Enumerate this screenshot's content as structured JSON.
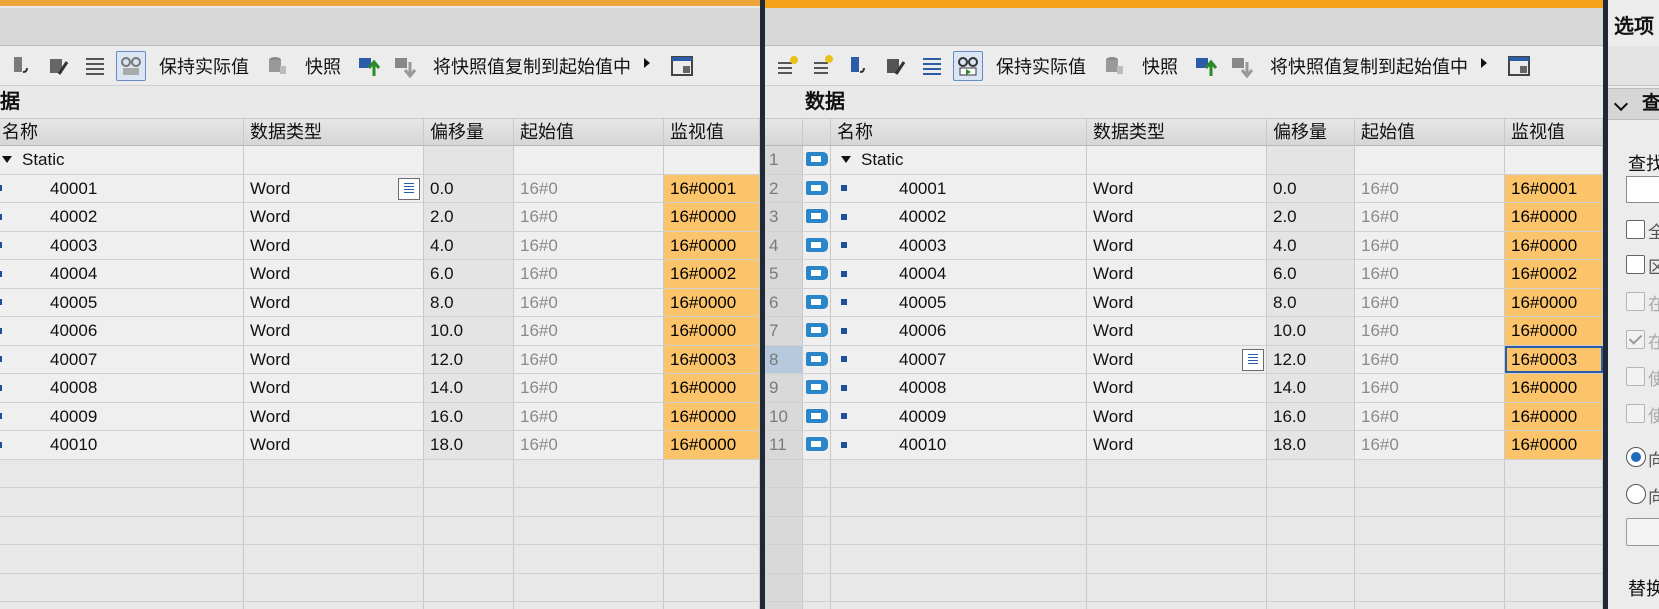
{
  "colors": {
    "accent": "#f7a31a",
    "monitor_cell": "#fbc46a",
    "tag_icon": "#2a86c8"
  },
  "toolbar": {
    "keep_actual": "保持实际值",
    "snapshot": "快照",
    "copy_snapshot": "将快照值复制到起始值中"
  },
  "left": {
    "section_title": "据",
    "headers": {
      "name": "名称",
      "type": "数据类型",
      "offset": "偏移量",
      "start": "起始值",
      "monitor": "监视值"
    },
    "group": "Static"
  },
  "right": {
    "section_title": "数据",
    "headers": {
      "name": "名称",
      "type": "数据类型",
      "offset": "偏移量",
      "start": "起始值",
      "monitor": "监视值"
    },
    "group_num": "1",
    "group": "Static"
  },
  "rows": [
    {
      "num": "2",
      "name": "40001",
      "type": "Word",
      "offset": "0.0",
      "start": "16#0",
      "monitor": "16#0001"
    },
    {
      "num": "3",
      "name": "40002",
      "type": "Word",
      "offset": "2.0",
      "start": "16#0",
      "monitor": "16#0000"
    },
    {
      "num": "4",
      "name": "40003",
      "type": "Word",
      "offset": "4.0",
      "start": "16#0",
      "monitor": "16#0000"
    },
    {
      "num": "5",
      "name": "40004",
      "type": "Word",
      "offset": "6.0",
      "start": "16#0",
      "monitor": "16#0002"
    },
    {
      "num": "6",
      "name": "40005",
      "type": "Word",
      "offset": "8.0",
      "start": "16#0",
      "monitor": "16#0000"
    },
    {
      "num": "7",
      "name": "40006",
      "type": "Word",
      "offset": "10.0",
      "start": "16#0",
      "monitor": "16#0000"
    },
    {
      "num": "8",
      "name": "40007",
      "type": "Word",
      "offset": "12.0",
      "start": "16#0",
      "monitor": "16#0003"
    },
    {
      "num": "9",
      "name": "40008",
      "type": "Word",
      "offset": "14.0",
      "start": "16#0",
      "monitor": "16#0000"
    },
    {
      "num": "10",
      "name": "40009",
      "type": "Word",
      "offset": "16.0",
      "start": "16#0",
      "monitor": "16#0000"
    },
    {
      "num": "11",
      "name": "40010",
      "type": "Word",
      "offset": "18.0",
      "start": "16#0",
      "monitor": "16#0000"
    }
  ],
  "sidepanel": {
    "title": "选项",
    "section": "查",
    "find_label": "查找",
    "clip": [
      "全",
      "区",
      "在",
      "在",
      "使",
      "使"
    ],
    "radio_clip": [
      "向",
      "向"
    ],
    "replace_label": "替换"
  }
}
